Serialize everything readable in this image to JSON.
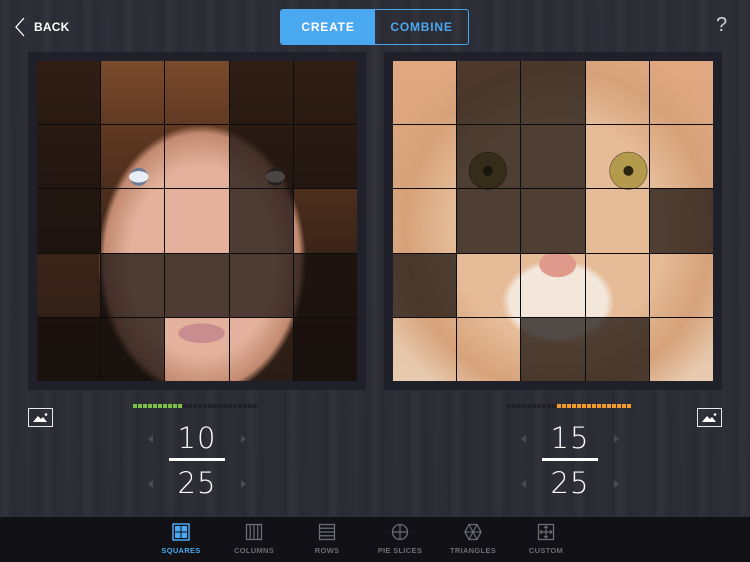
{
  "header": {
    "back_label": "BACK",
    "segments": [
      {
        "label": "CREATE",
        "active": true
      },
      {
        "label": "COMBINE",
        "active": false
      }
    ],
    "help_label": "?"
  },
  "colors": {
    "accent": "#4aa8f0",
    "left_meter": "#7cc043",
    "right_meter": "#f29a2a",
    "background": "#2a2b33",
    "toolbar": "#111116"
  },
  "left_puzzle": {
    "subject": "boy-face",
    "grid_size": 5,
    "selected": [
      [
        0,
        1,
        1,
        0,
        0
      ],
      [
        0,
        1,
        1,
        0,
        0
      ],
      [
        0,
        1,
        1,
        0,
        1
      ],
      [
        1,
        0,
        0,
        0,
        0
      ],
      [
        0,
        0,
        1,
        1,
        0
      ]
    ],
    "numerator": "10",
    "denominator": "25",
    "meter_total": 25,
    "meter_filled": 10,
    "image_icon": "image-icon"
  },
  "right_puzzle": {
    "subject": "kitten-face",
    "grid_size": 5,
    "selected": [
      [
        1,
        0,
        0,
        1,
        1
      ],
      [
        1,
        0,
        0,
        1,
        1
      ],
      [
        1,
        0,
        0,
        1,
        0
      ],
      [
        0,
        1,
        1,
        1,
        1
      ],
      [
        1,
        1,
        0,
        0,
        1
      ]
    ],
    "numerator": "15",
    "denominator": "25",
    "meter_total": 25,
    "meter_filled": 15,
    "image_icon": "image-icon"
  },
  "toolbar": {
    "items": [
      {
        "label": "SQUARES",
        "icon": "squares-icon",
        "active": true
      },
      {
        "label": "COLUMNS",
        "icon": "columns-icon",
        "active": false
      },
      {
        "label": "ROWS",
        "icon": "rows-icon",
        "active": false
      },
      {
        "label": "PIE SLICES",
        "icon": "pie-slices-icon",
        "active": false
      },
      {
        "label": "TRIANGLES",
        "icon": "triangles-icon",
        "active": false
      },
      {
        "label": "CUSTOM",
        "icon": "custom-icon",
        "active": false
      }
    ]
  }
}
